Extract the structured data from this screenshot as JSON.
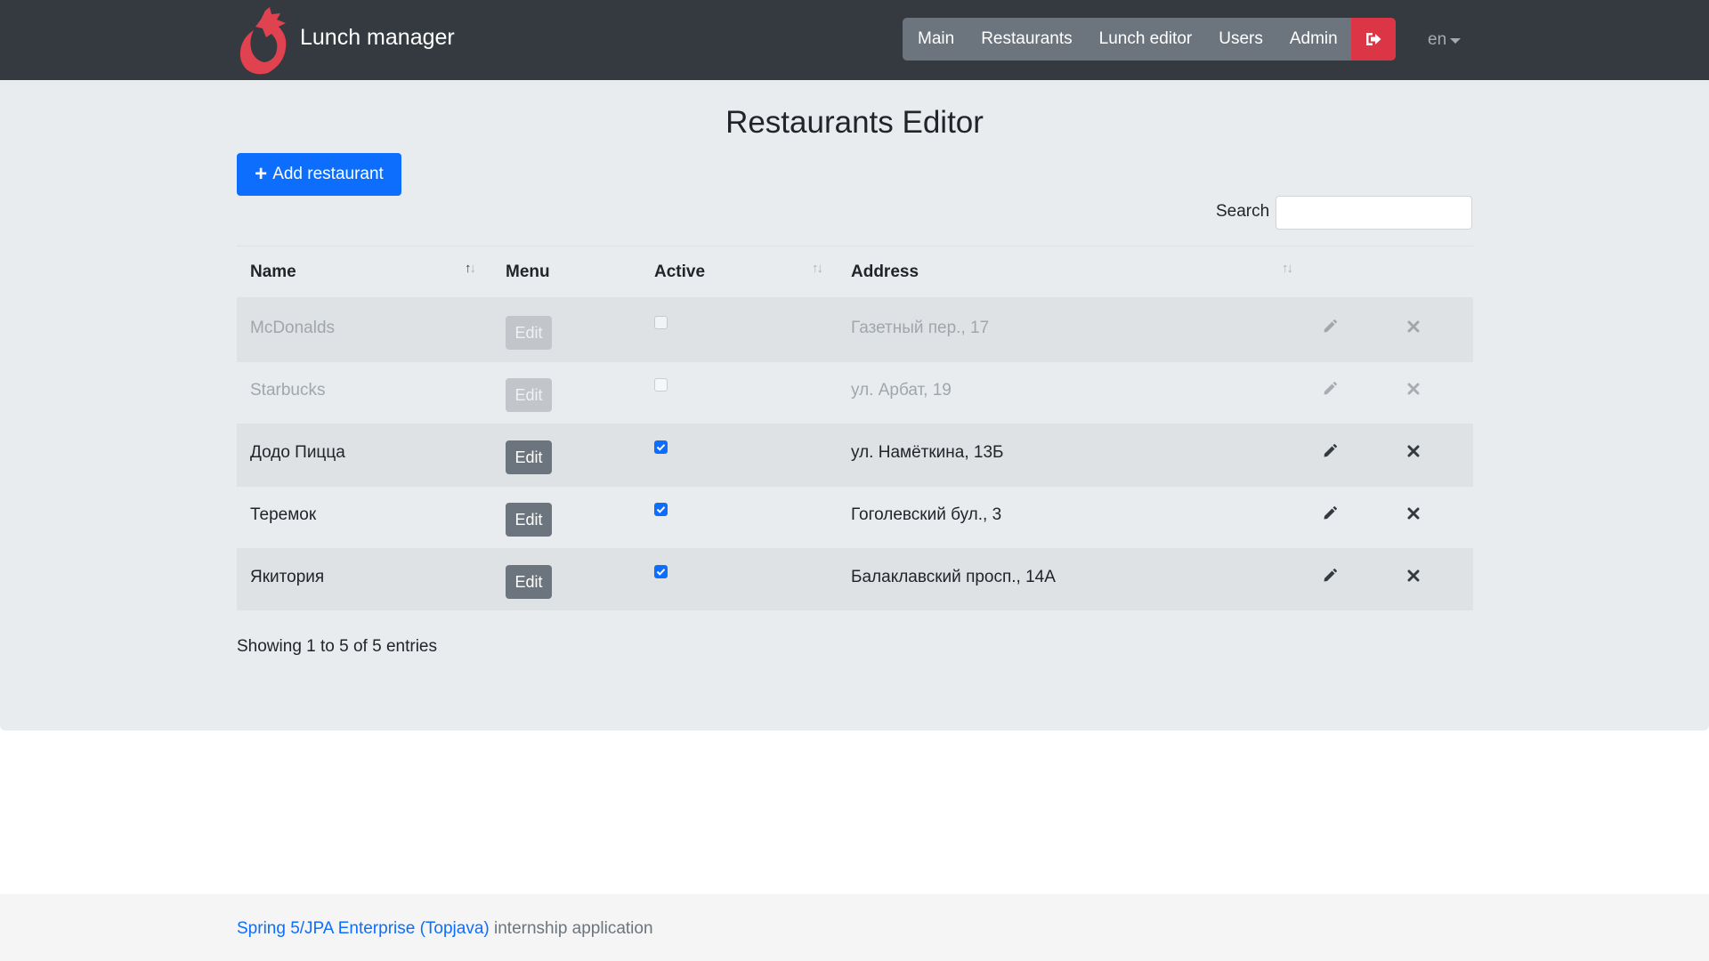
{
  "navbar": {
    "brand": "Lunch manager",
    "items": [
      {
        "label": "Main"
      },
      {
        "label": "Restaurants"
      },
      {
        "label": "Lunch editor"
      },
      {
        "label": "Users"
      },
      {
        "label": "Admin"
      }
    ],
    "logout_icon": "sign-out-icon",
    "language": "en",
    "colors": {
      "navbar": "#343a40",
      "nav_button": "#6c757d",
      "logout": "#dc3545"
    }
  },
  "page": {
    "title": "Restaurants Editor",
    "add_button": "Add restaurant",
    "search_label": "Search",
    "search_value": ""
  },
  "table": {
    "headers": {
      "name": "Name",
      "menu": "Menu",
      "active": "Active",
      "address": "Address"
    },
    "edit_label": "Edit",
    "rows": [
      {
        "name": "McDonalds",
        "active": false,
        "address": "Газетный пер., 17"
      },
      {
        "name": "Starbucks",
        "active": false,
        "address": "ул. Арбат, 19"
      },
      {
        "name": "Додо Пицца",
        "active": true,
        "address": "ул. Намёткина, 13Б"
      },
      {
        "name": "Теремок",
        "active": true,
        "address": "Гоголевский бул., 3"
      },
      {
        "name": "Якитория",
        "active": true,
        "address": "Балаклавский просп., 14А"
      }
    ],
    "info": "Showing 1 to 5 of 5 entries"
  },
  "footer": {
    "link_text": "Spring 5/JPA Enterprise (Topjava)",
    "text": " internship application"
  },
  "colors": {
    "primary": "#0d6efd",
    "jumbotron": "#e9ecef"
  }
}
